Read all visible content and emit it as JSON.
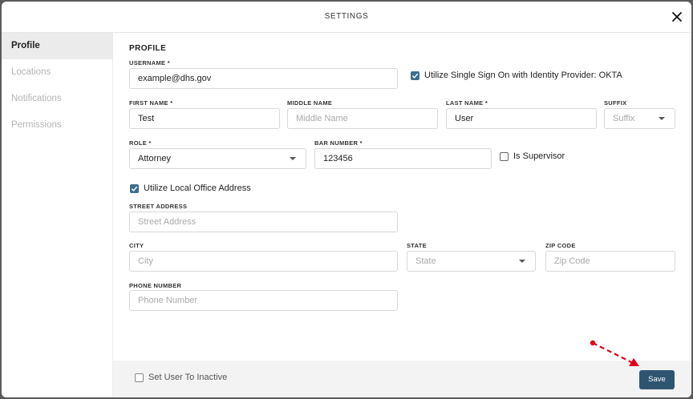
{
  "header": {
    "title": "SETTINGS"
  },
  "sidebar": {
    "items": [
      {
        "label": "Profile",
        "active": true
      },
      {
        "label": "Locations",
        "active": false
      },
      {
        "label": "Notifications",
        "active": false
      },
      {
        "label": "Permissions",
        "active": false
      }
    ]
  },
  "profile": {
    "section_title": "PROFILE",
    "username": {
      "label": "USERNAME *",
      "value": "example@dhs.gov"
    },
    "sso_checkbox": {
      "label": "Utilize Single Sign On with Identity Provider: OKTA",
      "checked": true
    },
    "first_name": {
      "label": "FIRST NAME *",
      "value": "Test"
    },
    "middle_name": {
      "label": "MIDDLE NAME",
      "placeholder": "Middle Name"
    },
    "last_name": {
      "label": "LAST NAME *",
      "value": "User"
    },
    "suffix": {
      "label": "SUFFIX",
      "placeholder": "Suffix"
    },
    "role": {
      "label": "ROLE *",
      "value": "Attorney"
    },
    "bar_number": {
      "label": "BAR NUMBER *",
      "value": "123456"
    },
    "supervisor_checkbox": {
      "label": "Is Supervisor",
      "checked": false
    },
    "local_office_checkbox": {
      "label": "Utilize Local Office Address",
      "checked": true
    },
    "street_address": {
      "label": "STREET ADDRESS",
      "placeholder": "Street Address"
    },
    "city": {
      "label": "CITY",
      "placeholder": "City"
    },
    "state": {
      "label": "STATE",
      "placeholder": "State"
    },
    "zip_code": {
      "label": "ZIP CODE",
      "placeholder": "Zip Code"
    },
    "phone_number": {
      "label": "PHONE NUMBER",
      "placeholder": "Phone Number"
    }
  },
  "footer": {
    "inactive_checkbox": {
      "label": "Set User To Inactive",
      "checked": false
    },
    "save_label": "Save"
  },
  "colors": {
    "accent": "#3d6f8c",
    "save_button": "#2e5570",
    "annotation_arrow": "#e0001b"
  },
  "icons": {
    "close": "close-icon",
    "checkmark": "checkmark-icon",
    "dropdown": "chevron-down-icon"
  }
}
